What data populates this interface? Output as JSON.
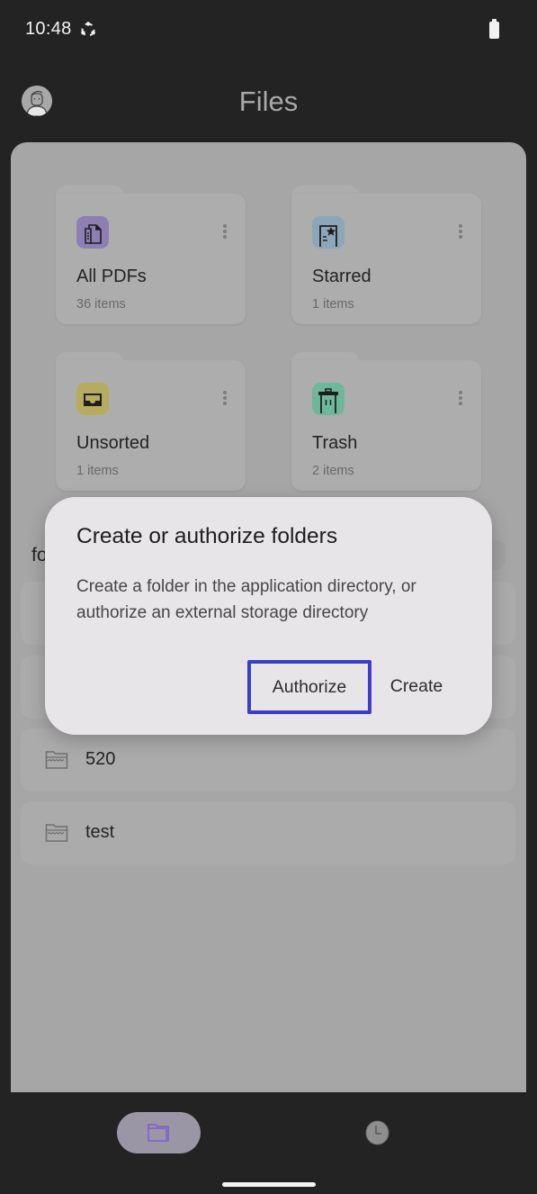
{
  "status_bar": {
    "time": "10:48",
    "icons": [
      "sync-icon",
      "battery-icon"
    ]
  },
  "app_bar": {
    "title": "Files",
    "avatar_icon": "person-avatar-icon"
  },
  "categories": [
    {
      "name": "All PDFs",
      "count": "36 items",
      "icon": "documents-icon",
      "icon_bg": "#8e7fb3"
    },
    {
      "name": "Starred",
      "count": "1 items",
      "icon": "starred-document-icon",
      "icon_bg": "#8ea6b9"
    },
    {
      "name": "Unsorted",
      "count": "1 items",
      "icon": "inbox-tray-icon",
      "icon_bg": "#b7ac5e"
    },
    {
      "name": "Trash",
      "count": "2 items",
      "icon": "trash-icon",
      "icon_bg": "#6fb79b"
    }
  ],
  "folders_section": {
    "label_visible": "fo"
  },
  "folders": [
    {
      "name": "520"
    },
    {
      "name": "test"
    }
  ],
  "dialog": {
    "title": "Create or authorize folders",
    "message": "Create a folder in the application directory, or authorize an external storage directory",
    "buttons": {
      "authorize": "Authorize",
      "create": "Create"
    },
    "highlight_color": "#3d3dcc"
  },
  "bottom_nav": {
    "items": [
      {
        "id": "files",
        "icon": "folder-icon",
        "selected": true
      },
      {
        "id": "history",
        "icon": "clock-icon",
        "selected": false
      }
    ],
    "accent": "#7d5fd0"
  }
}
